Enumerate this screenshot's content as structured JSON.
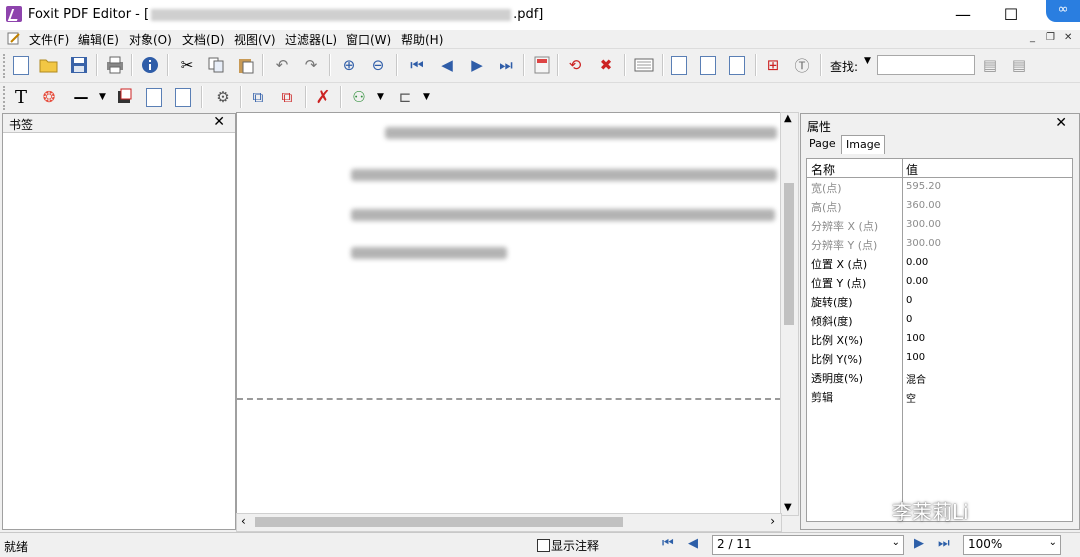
{
  "window": {
    "title_prefix": "Foxit PDF Editor - [",
    "title_suffix": ".pdf]",
    "min_glyph": "—",
    "max_glyph": "☐",
    "close_glyph": "✕",
    "badge_glyph": "∞"
  },
  "menu": {
    "items": [
      "文件(F)",
      "编辑(E)",
      "对象(O)",
      "文档(D)",
      "视图(V)",
      "过滤器(L)",
      "窗口(W)",
      "帮助(H)"
    ],
    "mdi_min": "_",
    "mdi_restore": "❐",
    "mdi_close": "✕"
  },
  "toolbar": {
    "find_label": "查找:",
    "find_value": "",
    "icons": [
      "new-file",
      "open-folder",
      "save",
      "print",
      "info",
      "cut",
      "copy",
      "paste",
      "undo",
      "redo",
      "zoom-in",
      "zoom-out",
      "first-page",
      "prev-page",
      "next-page",
      "last-page",
      "calculator",
      "rotate-page",
      "delete-page",
      "crop-page",
      "text-tool",
      "image-tool",
      "shape-tool",
      "insert-page",
      "stamp",
      "find-prev",
      "find-next"
    ]
  },
  "bookmarks": {
    "title": "书签",
    "close_glyph": "✕"
  },
  "properties": {
    "title": "属性",
    "close_glyph": "✕",
    "tabs": [
      "Page",
      "Image"
    ],
    "active_tab": "Image",
    "col_name": "名称",
    "col_value": "值",
    "rows": [
      {
        "name": "宽(点)",
        "value": "595.20",
        "muted": true
      },
      {
        "name": "高(点)",
        "value": "360.00",
        "muted": true
      },
      {
        "name": "分辨率 X (点)",
        "value": "300.00",
        "muted": true
      },
      {
        "name": "分辨率 Y (点)",
        "value": "300.00",
        "muted": true
      },
      {
        "name": "位置 X (点)",
        "value": "0.00",
        "muted": false
      },
      {
        "name": "位置 Y (点)",
        "value": "0.00",
        "muted": false
      },
      {
        "name": "旋转(度)",
        "value": "0",
        "muted": false
      },
      {
        "name": "倾斜(度)",
        "value": "0",
        "muted": false
      },
      {
        "name": "比例 X(%)",
        "value": "100",
        "muted": false
      },
      {
        "name": "比例 Y(%)",
        "value": "100",
        "muted": false
      },
      {
        "name": "透明度(%)",
        "value": "混合",
        "muted": false
      },
      {
        "name": "剪辑",
        "value": "空",
        "muted": false
      }
    ]
  },
  "status": {
    "text": "就绪",
    "show_annotations": "显示注释",
    "page": "2 / 11",
    "zoom": "100%"
  },
  "watermark": "李茉莉Li"
}
